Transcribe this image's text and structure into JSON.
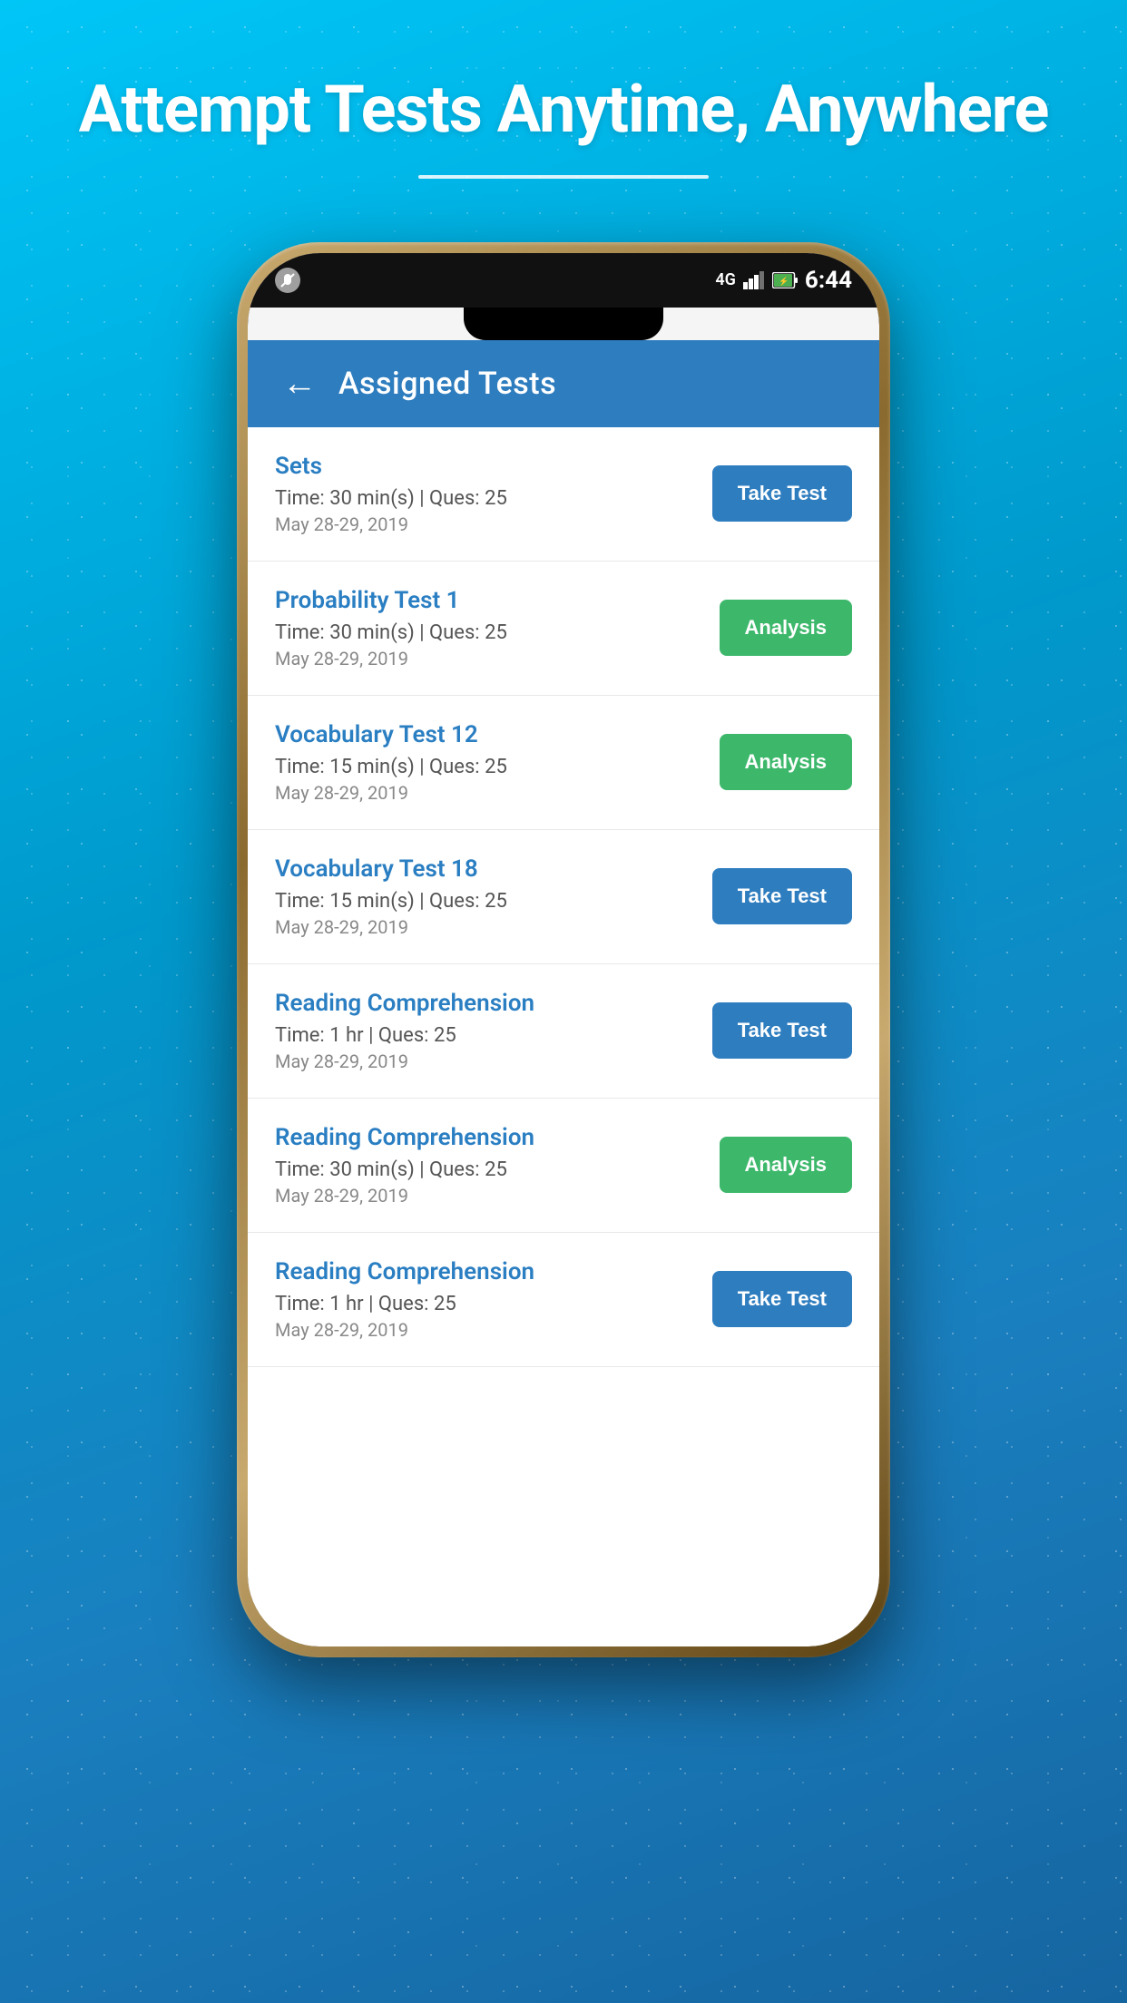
{
  "page": {
    "background_title": "Attempt Tests Anytime, Anywhere",
    "background_colors": {
      "top": "#00c6f7",
      "bottom": "#1565a0"
    }
  },
  "status_bar": {
    "time": "6:44",
    "signal": "4G",
    "battery_charging": true
  },
  "app_bar": {
    "title": "Assigned Tests",
    "back_label": "←"
  },
  "tests": [
    {
      "id": 1,
      "name": "Sets",
      "time": "Time: 30 min(s) | Ques: 25",
      "date": "May 28-29, 2019",
      "button_type": "take_test",
      "button_label": "Take Test"
    },
    {
      "id": 2,
      "name": "Probability Test 1",
      "time": "Time: 30 min(s) | Ques: 25",
      "date": "May 28-29, 2019",
      "button_type": "analysis",
      "button_label": "Analysis"
    },
    {
      "id": 3,
      "name": "Vocabulary Test 12",
      "time": "Time: 15 min(s) | Ques: 25",
      "date": "May 28-29, 2019",
      "button_type": "analysis",
      "button_label": "Analysis"
    },
    {
      "id": 4,
      "name": "Vocabulary Test 18",
      "time": "Time: 15 min(s) | Ques: 25",
      "date": "May 28-29, 2019",
      "button_type": "take_test",
      "button_label": "Take Test"
    },
    {
      "id": 5,
      "name": "Reading Comprehension",
      "time": "Time: 1 hr | Ques: 25",
      "date": "May 28-29, 2019",
      "button_type": "take_test",
      "button_label": "Take Test"
    },
    {
      "id": 6,
      "name": "Reading Comprehension",
      "time": "Time: 30 min(s) | Ques: 25",
      "date": "May 28-29, 2019",
      "button_type": "analysis",
      "button_label": "Analysis"
    },
    {
      "id": 7,
      "name": "Reading Comprehension",
      "time": "Time: 1 hr | Ques: 25",
      "date": "May 28-29, 2019",
      "button_type": "take_test",
      "button_label": "Take Test"
    }
  ]
}
